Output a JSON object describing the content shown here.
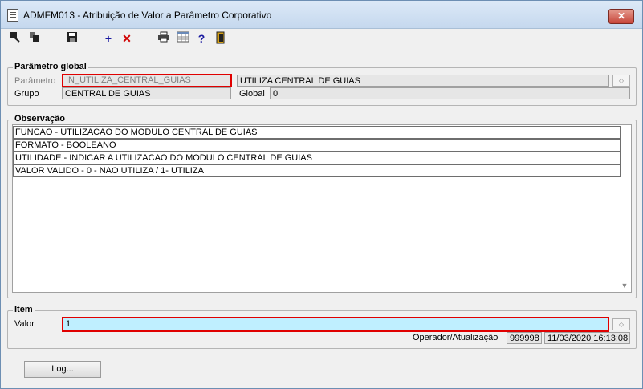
{
  "window": {
    "title": "ADMFM013 - Atribuição de Valor a Parâmetro Corporativo",
    "close_glyph": "✕"
  },
  "toolbar": {
    "icons": [
      "nav-back-icon",
      "nav-copy-icon",
      "save-icon",
      "add-icon",
      "delete-icon",
      "print-icon",
      "grid-icon",
      "help-icon",
      "exit-icon"
    ],
    "add_glyph": "+",
    "delete_glyph": "✕",
    "help_glyph": "?"
  },
  "parametro_global": {
    "legend": "Parâmetro global",
    "parametro_label": "Parâmetro",
    "parametro_value": "IN_UTILIZA_CENTRAL_GUIAS",
    "descricao_value": "UTILIZA CENTRAL DE GUIAS",
    "grupo_label": "Grupo",
    "grupo_value": "CENTRAL DE GUIAS",
    "global_label": "Global",
    "global_value": "0"
  },
  "observacao": {
    "legend": "Observação",
    "lines": [
      "FUNCAO - UTILIZACAO DO MODULO CENTRAL DE GUIAS",
      "FORMATO - BOOLEANO",
      "UTILIDADE - INDICAR A UTILIZACAO DO MODULO CENTRAL DE GUIAS",
      "VALOR VALIDO - 0 - NAO UTILIZA / 1- UTILIZA"
    ]
  },
  "item": {
    "legend": "Item",
    "valor_label": "Valor",
    "valor_value": "1",
    "operador_label": "Operador/Atualização",
    "operador_value": "999998",
    "atualizacao_value": "11/03/2020 16:13:08"
  },
  "footer": {
    "log_button": "Log..."
  },
  "colors": {
    "valor_bg": "#bfefff",
    "highlight": "#e00000",
    "title_bar": "#c5d8ee"
  }
}
